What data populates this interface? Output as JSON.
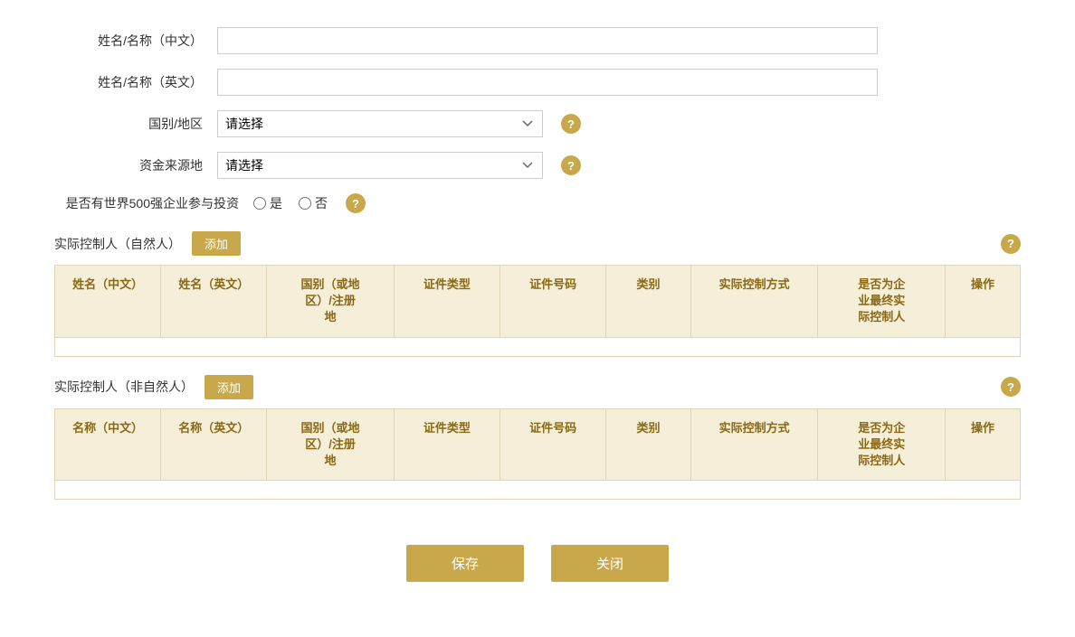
{
  "form": {
    "name_cn_label": "姓名/名称（中文）",
    "name_en_label": "姓名/名称（英文）",
    "country_label": "国别/地区",
    "fund_source_label": "资金来源地",
    "fortune500_label": "是否有世界500强企业参与投资",
    "country_placeholder": "请选择",
    "fund_source_placeholder": "请选择",
    "radio_yes": "是",
    "radio_no": "否"
  },
  "natural_person": {
    "section_title": "实际控制人（自然人）",
    "add_btn": "添加",
    "columns": [
      "姓名（中文）",
      "姓名（英文）",
      "国别（或地区）/注册地",
      "证件类型",
      "证件号码",
      "类别",
      "实际控制方式",
      "是否为企业最终实际控制人",
      "操作"
    ]
  },
  "non_natural_person": {
    "section_title": "实际控制人（非自然人）",
    "add_btn": "添加",
    "columns": [
      "名称（中文）",
      "名称（英文）",
      "国别（或地区）/注册地",
      "证件类型",
      "证件号码",
      "类别",
      "实际控制方式",
      "是否为企业最终实际控制人",
      "操作"
    ]
  },
  "buttons": {
    "save": "保存",
    "close": "关闭"
  },
  "help_icon": "?",
  "colors": {
    "gold": "#c8a84b",
    "table_header_bg": "#f5eed8",
    "table_header_text": "#8b6914",
    "table_border": "#e0d5b5"
  }
}
